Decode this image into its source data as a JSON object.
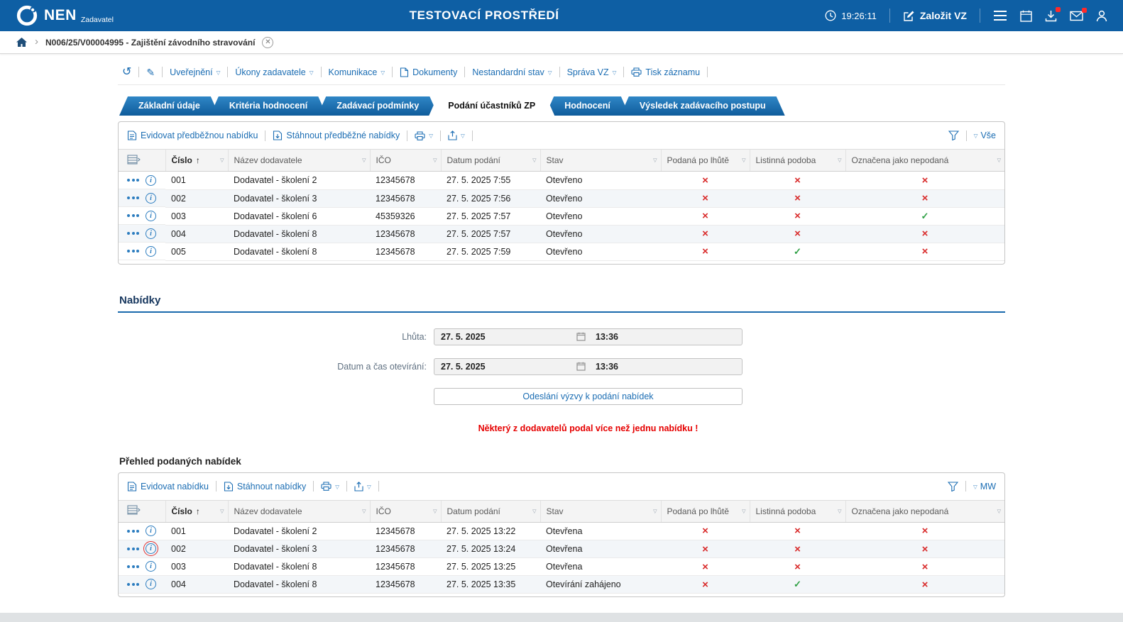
{
  "topbar": {
    "logo": "NEN",
    "logo_sub": "Zadavatel",
    "env_title": "TESTOVACÍ PROSTŘEDÍ",
    "time": "19:26:11",
    "create_btn": "Založit VZ"
  },
  "breadcrumb": {
    "record": "N006/25/V00004995 - Zajištění závodního stravování"
  },
  "record_toolbar": {
    "menus": [
      {
        "label": "Uveřejnění",
        "dropdown": true,
        "icon": ""
      },
      {
        "label": "Úkony zadavatele",
        "dropdown": true,
        "icon": ""
      },
      {
        "label": "Komunikace",
        "dropdown": true,
        "icon": ""
      },
      {
        "label": "Dokumenty",
        "dropdown": false,
        "icon": "document"
      },
      {
        "label": "Nestandardní stav",
        "dropdown": true,
        "icon": ""
      },
      {
        "label": "Správa VZ",
        "dropdown": true,
        "icon": ""
      },
      {
        "label": "Tisk záznamu",
        "dropdown": false,
        "icon": "printer"
      }
    ]
  },
  "tabs": [
    {
      "label": "Základní údaje",
      "active": false
    },
    {
      "label": "Kritéria hodnocení",
      "active": false
    },
    {
      "label": "Zadávací podmínky",
      "active": false
    },
    {
      "label": "Podání účastníků ZP",
      "active": true
    },
    {
      "label": "Hodnocení",
      "active": false
    },
    {
      "label": "Výsledek zadávacího postupu",
      "active": false
    }
  ],
  "columns": [
    "Číslo",
    "Název dodavatele",
    "IČO",
    "Datum podání",
    "Stav",
    "Podaná po lhůtě",
    "Listinná podoba",
    "Označena jako nepodaná"
  ],
  "preliminary": {
    "actions": {
      "evidovat": "Evidovat předběžnou nabídku",
      "stahnout": "Stáhnout předběžné nabídky",
      "filter_label": "Vše"
    },
    "rows": [
      {
        "num": "001",
        "supplier": "Dodavatel - školení 2",
        "ico": "12345678",
        "submitted": "27. 5. 2025 7:55",
        "status": "Otevřeno",
        "late": false,
        "paper": false,
        "marked_not_submitted": false,
        "highlight": false
      },
      {
        "num": "002",
        "supplier": "Dodavatel - školení 3",
        "ico": "12345678",
        "submitted": "27. 5. 2025 7:56",
        "status": "Otevřeno",
        "late": false,
        "paper": false,
        "marked_not_submitted": false,
        "highlight": false
      },
      {
        "num": "003",
        "supplier": "Dodavatel - školení 6",
        "ico": "45359326",
        "submitted": "27. 5. 2025 7:57",
        "status": "Otevřeno",
        "late": false,
        "paper": false,
        "marked_not_submitted": true,
        "highlight": false
      },
      {
        "num": "004",
        "supplier": "Dodavatel - školení 8",
        "ico": "12345678",
        "submitted": "27. 5. 2025 7:57",
        "status": "Otevřeno",
        "late": false,
        "paper": false,
        "marked_not_submitted": false,
        "highlight": false
      },
      {
        "num": "005",
        "supplier": "Dodavatel - školení 8",
        "ico": "12345678",
        "submitted": "27. 5. 2025 7:59",
        "status": "Otevřeno",
        "late": false,
        "paper": true,
        "marked_not_submitted": false,
        "highlight": false
      }
    ]
  },
  "offers_section": {
    "title": "Nabídky",
    "deadline_label": "Lhůta:",
    "deadline_date": "27. 5. 2025",
    "deadline_time": "13:36",
    "opening_label": "Datum a čas otevírání:",
    "opening_date": "27. 5. 2025",
    "opening_time": "13:36",
    "send_button": "Odeslání výzvy k podání nabídek",
    "warning": "Některý z dodavatelů podal více než jednu nabídku !"
  },
  "submitted": {
    "title": "Přehled podaných nabídek",
    "actions": {
      "evidovat": "Evidovat nabídku",
      "stahnout": "Stáhnout nabídky",
      "filter_label": "MW"
    },
    "rows": [
      {
        "num": "001",
        "supplier": "Dodavatel - školení 2",
        "ico": "12345678",
        "submitted": "27. 5. 2025 13:22",
        "status": "Otevřena",
        "late": false,
        "paper": false,
        "marked_not_submitted": false,
        "highlight": false
      },
      {
        "num": "002",
        "supplier": "Dodavatel - školení 3",
        "ico": "12345678",
        "submitted": "27. 5. 2025 13:24",
        "status": "Otevřena",
        "late": false,
        "paper": false,
        "marked_not_submitted": false,
        "highlight": true
      },
      {
        "num": "003",
        "supplier": "Dodavatel - školení 8",
        "ico": "12345678",
        "submitted": "27. 5. 2025 13:25",
        "status": "Otevřena",
        "late": false,
        "paper": false,
        "marked_not_submitted": false,
        "highlight": false
      },
      {
        "num": "004",
        "supplier": "Dodavatel - školení 8",
        "ico": "12345678",
        "submitted": "27. 5. 2025 13:35",
        "status": "Otevírání zahájeno",
        "late": false,
        "paper": true,
        "marked_not_submitted": false,
        "highlight": false
      }
    ]
  },
  "colors": {
    "header_blue": "#0e5fa4",
    "link_blue": "#1b6db3",
    "accent_red": "#d92b2b",
    "accent_green": "#2fa045"
  }
}
